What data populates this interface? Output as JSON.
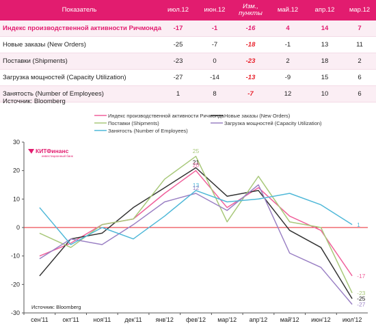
{
  "table": {
    "header": {
      "indicator": "Показатель",
      "months": [
        "июл.12",
        "июн.12",
        "Изм., пункты",
        "май.12",
        "апр.12",
        "мар.12"
      ]
    },
    "rows": [
      {
        "name": "Индекс производственной активности Ричмонда",
        "values": [
          "-17",
          "-1",
          "-16",
          "4",
          "14",
          "7"
        ]
      },
      {
        "name": "Новые заказы (New Orders)",
        "values": [
          "-25",
          "-7",
          "-18",
          "-1",
          "13",
          "11"
        ]
      },
      {
        "name": "Поставки (Shipments)",
        "values": [
          "-23",
          "0",
          "-23",
          "2",
          "18",
          "2"
        ]
      },
      {
        "name": "Загрузка мощностей (Capacity Utilization)",
        "values": [
          "-27",
          "-14",
          "-13",
          "-9",
          "15",
          "6"
        ]
      },
      {
        "name": "Занятость (Number of Employees)",
        "values": [
          "1",
          "8",
          "-7",
          "12",
          "10",
          "6"
        ]
      }
    ]
  },
  "source_top": "Источник: Bloomberg",
  "chart_data": {
    "type": "line",
    "categories": [
      "сен'11",
      "окт'11",
      "ноя'11",
      "дек'11",
      "янв'12",
      "фев'12",
      "мар'12",
      "апр'12",
      "май'12",
      "июн'12",
      "июл'12"
    ],
    "ylim": [
      -30,
      30
    ],
    "yticks": [
      -30,
      -20,
      -10,
      0,
      10,
      20,
      30
    ],
    "legend_placement": "top",
    "grid": false,
    "series": [
      {
        "name": "Индекс производственной активности Ричмонда",
        "color": "#f0609b",
        "values": [
          -10,
          -5.5,
          1,
          3,
          12,
          20,
          7,
          14,
          4,
          -1,
          -17
        ]
      },
      {
        "name": "Новые заказы (New Orders)",
        "color": "#333333",
        "values": [
          -17,
          -4,
          -2,
          7,
          14,
          21,
          11,
          13,
          -1,
          -7,
          -25
        ]
      },
      {
        "name": "Поставки (Shipments)",
        "color": "#a8c87a",
        "values": [
          -2,
          -7,
          1,
          3,
          17,
          25,
          2,
          18,
          2,
          0,
          -23
        ]
      },
      {
        "name": "Загрузка мощностей (Capacity Utilization)",
        "color": "#9a80c4",
        "values": [
          -11,
          -4,
          -6,
          1,
          9,
          12,
          6,
          15,
          -9,
          -14,
          -27
        ]
      },
      {
        "name": "Занятость (Number of Employees)",
        "color": "#4fb8d8",
        "values": [
          7,
          -6,
          0,
          -4,
          4,
          13,
          9,
          10,
          12,
          8,
          1
        ]
      }
    ],
    "data_labels": [
      {
        "series": 2,
        "index": 5,
        "text": "25"
      },
      {
        "series": 1,
        "index": 5,
        "text": "21"
      },
      {
        "series": 0,
        "index": 5,
        "text": "20"
      },
      {
        "series": 4,
        "index": 5,
        "text": "13"
      },
      {
        "series": 3,
        "index": 5,
        "text": "12"
      },
      {
        "series": 4,
        "index": 10,
        "text": "1"
      },
      {
        "series": 0,
        "index": 10,
        "text": "-17"
      },
      {
        "series": 2,
        "index": 10,
        "text": "-23"
      },
      {
        "series": 1,
        "index": 10,
        "text": "-25"
      },
      {
        "series": 3,
        "index": 10,
        "text": "-27"
      }
    ],
    "source": "Источник: Bloomberg",
    "logo": {
      "text": "КИТФинанс",
      "tagline": "инвестиционный банк"
    }
  }
}
